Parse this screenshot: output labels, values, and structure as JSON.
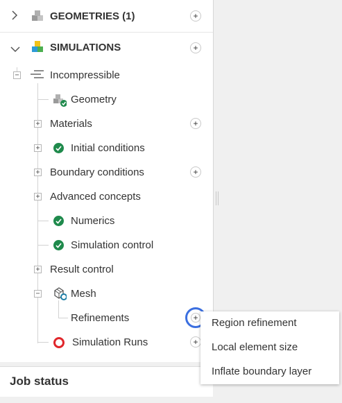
{
  "tree": {
    "geometries": {
      "label": "GEOMETRIES (1)",
      "add": "+"
    },
    "simulations": {
      "label": "SIMULATIONS",
      "add": "+"
    },
    "items": [
      {
        "label": "Incompressible",
        "expander": "−"
      },
      {
        "label": "Geometry"
      },
      {
        "label": "Materials",
        "expander": "+",
        "add": "+"
      },
      {
        "label": "Initial conditions",
        "expander": "+"
      },
      {
        "label": "Boundary conditions",
        "expander": "+",
        "add": "+"
      },
      {
        "label": "Advanced concepts",
        "expander": "+"
      },
      {
        "label": "Numerics"
      },
      {
        "label": "Simulation control"
      },
      {
        "label": "Result control",
        "expander": "+"
      },
      {
        "label": "Mesh",
        "expander": "−"
      },
      {
        "label": "Refinements",
        "add": "+"
      },
      {
        "label": "Simulation Runs",
        "add": "+"
      }
    ]
  },
  "job_status": {
    "label": "Job status"
  },
  "context_menu": {
    "items": [
      "Region refinement",
      "Local element size",
      "Inflate boundary layer"
    ]
  },
  "colors": {
    "check": "#1f8a4c",
    "error": "#e0262b",
    "focus": "#3b6fe0"
  }
}
